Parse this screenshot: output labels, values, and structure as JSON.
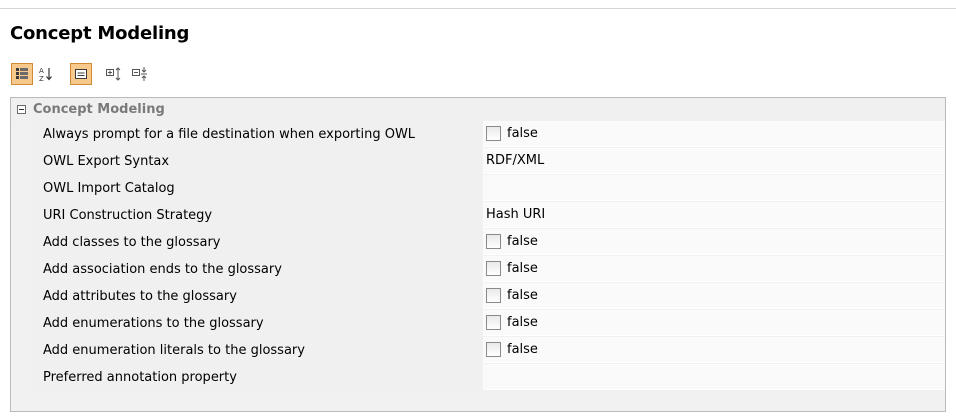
{
  "page": {
    "title": "Concept Modeling"
  },
  "toolbar": {
    "buttons": [
      {
        "name": "categorized-view-icon",
        "active": true
      },
      {
        "name": "sort-alphabetically-icon",
        "active": false
      },
      {
        "name": "show-description-icon",
        "active": true
      },
      {
        "name": "expand-all-icon",
        "active": false
      },
      {
        "name": "collapse-all-icon",
        "active": false
      }
    ]
  },
  "group": {
    "label": "Concept Modeling",
    "rows": [
      {
        "name": "Always prompt for a file destination when exporting OWL",
        "type": "checkbox",
        "value": "false"
      },
      {
        "name": "OWL Export Syntax",
        "type": "text",
        "value": "RDF/XML"
      },
      {
        "name": "OWL Import Catalog",
        "type": "text",
        "value": ""
      },
      {
        "name": "URI Construction Strategy",
        "type": "text",
        "value": "Hash URI"
      },
      {
        "name": "Add classes to the glossary",
        "type": "checkbox",
        "value": "false"
      },
      {
        "name": "Add association ends to the glossary",
        "type": "checkbox",
        "value": "false"
      },
      {
        "name": "Add attributes to the glossary",
        "type": "checkbox",
        "value": "false"
      },
      {
        "name": "Add enumerations to the glossary",
        "type": "checkbox",
        "value": "false"
      },
      {
        "name": "Add enumeration literals to the glossary",
        "type": "checkbox",
        "value": "false"
      },
      {
        "name": "Preferred annotation property",
        "type": "text",
        "value": ""
      }
    ]
  }
}
